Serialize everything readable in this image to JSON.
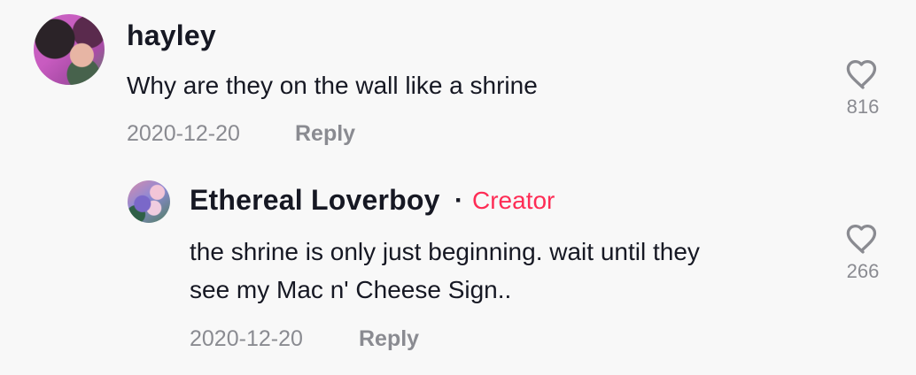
{
  "comments": [
    {
      "username": "hayley",
      "text": "Why are they on the wall like a shrine",
      "date": "2020-12-20",
      "reply_label": "Reply",
      "likes": "816"
    },
    {
      "username": "Ethereal Loverboy",
      "separator": "·",
      "badge": "Creator",
      "text_lines": [
        "the shrine is only just beginning. wait until they",
        "see my Mac n' Cheese Sign.."
      ],
      "date": "2020-12-20",
      "reply_label": "Reply",
      "likes": "266"
    }
  ],
  "icons": {
    "avatar_primary": "user-avatar",
    "avatar_reply": "creator-avatar",
    "like": "heart-outline-icon"
  },
  "colors": {
    "background": "#f8f8f8",
    "text": "#161823",
    "muted": "#8a8b91",
    "accent": "#fe2c55"
  }
}
